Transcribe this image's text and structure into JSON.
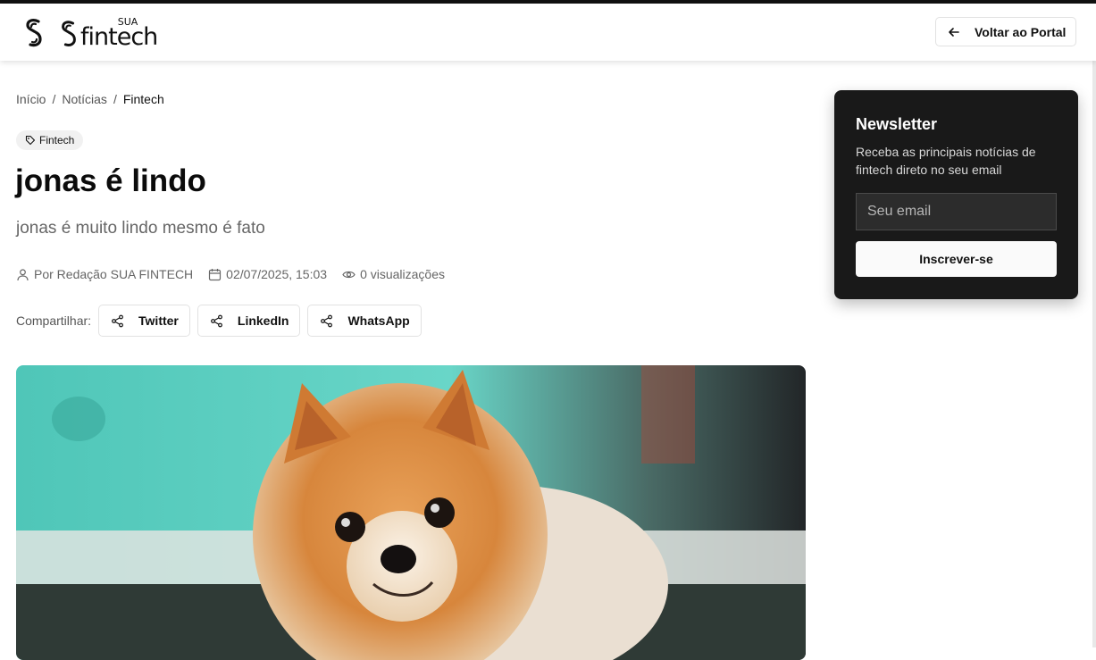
{
  "header": {
    "logo_word": "fintech",
    "logo_sup": "SUA",
    "back_label": "Voltar ao Portal"
  },
  "breadcrumb": {
    "items": [
      "Início",
      "Notícias",
      "Fintech"
    ],
    "separator": "/"
  },
  "article": {
    "tag": "Fintech",
    "title": "jonas é lindo",
    "subtitle": "jonas é muito lindo mesmo é fato",
    "author": "Por Redação SUA FINTECH",
    "date": "02/07/2025, 15:03",
    "views": "0 visualizações",
    "share_label": "Compartilhar:",
    "share_buttons": [
      "Twitter",
      "LinkedIn",
      "WhatsApp"
    ],
    "image_subject": "pomeranian-dog-photo"
  },
  "newsletter": {
    "title": "Newsletter",
    "description": "Receba as principais notícias de fintech direto no seu email",
    "email_placeholder": "Seu email",
    "email_value": "",
    "subscribe_label": "Inscrever-se"
  },
  "colors": {
    "newsletter_bg": "#191919",
    "accent_dark": "#111111",
    "tag_bg": "#f1f1f1",
    "hero_teal": "#5fd3c3"
  },
  "icons": {
    "back": "arrow-left-icon",
    "tag": "tag-icon",
    "author": "user-icon",
    "date": "calendar-icon",
    "views": "eye-icon",
    "share": "share-icon"
  }
}
